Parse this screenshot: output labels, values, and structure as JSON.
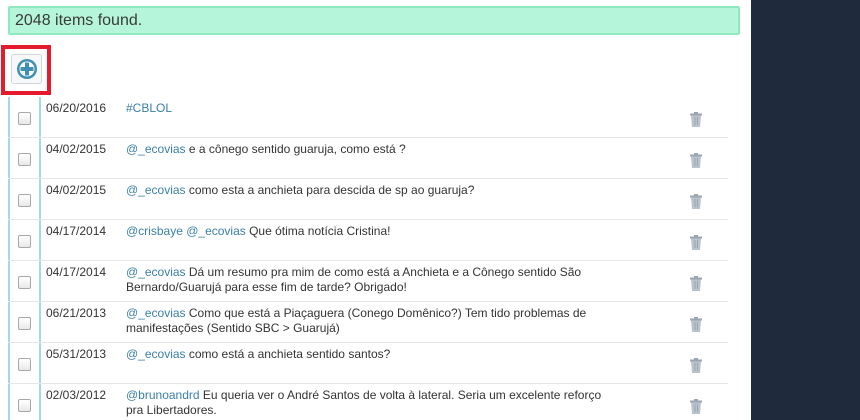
{
  "banner": {
    "text": "2048 items found."
  },
  "toolbar": {
    "add_icon": "plus-circle-icon"
  },
  "rows": [
    {
      "date": "06/20/2016",
      "parts": [
        {
          "t": "#CBLOL",
          "k": "hash"
        }
      ]
    },
    {
      "date": "04/02/2015",
      "parts": [
        {
          "t": "@_ecovias",
          "k": "mention"
        },
        {
          "t": " e a cônego sentido guaruja, como está ?",
          "k": "plain"
        }
      ]
    },
    {
      "date": "04/02/2015",
      "parts": [
        {
          "t": "@_ecovias",
          "k": "mention"
        },
        {
          "t": " como esta a anchieta para descida de sp ao guaruja?",
          "k": "plain"
        }
      ]
    },
    {
      "date": "04/17/2014",
      "parts": [
        {
          "t": "@crisbaye",
          "k": "mention"
        },
        {
          "t": " ",
          "k": "plain"
        },
        {
          "t": "@_ecovias",
          "k": "mention"
        },
        {
          "t": " Que ótima notícia Cristina!",
          "k": "plain"
        }
      ]
    },
    {
      "date": "04/17/2014",
      "parts": [
        {
          "t": "@_ecovias",
          "k": "mention"
        },
        {
          "t": " Dá um resumo pra mim de como está a Anchieta e a Cônego sentido São Bernardo/Guarujá para esse fim de tarde? Obrigado!",
          "k": "plain"
        }
      ]
    },
    {
      "date": "06/21/2013",
      "parts": [
        {
          "t": "@_ecovias",
          "k": "mention"
        },
        {
          "t": " Como que está a Piaçaguera (Conego Domênico?) Tem tido problemas de manifestações (Sentido SBC > Guarujá)",
          "k": "plain"
        }
      ]
    },
    {
      "date": "05/31/2013",
      "parts": [
        {
          "t": "@_ecovias",
          "k": "mention"
        },
        {
          "t": " como está a anchieta sentido santos?",
          "k": "plain"
        }
      ]
    },
    {
      "date": "02/03/2012",
      "parts": [
        {
          "t": "@brunoandrd",
          "k": "mention"
        },
        {
          "t": " Eu queria ver o André Santos de volta à lateral. Seria um excelente reforço pra Libertadores.",
          "k": "plain"
        }
      ]
    }
  ],
  "icons": {
    "row_delete": "trash-icon"
  },
  "colors": {
    "banner_bg": "#b5f5d9",
    "link": "#3a7fa8",
    "highlight": "#e31b2c",
    "sidebar": "#1f2a3d"
  }
}
